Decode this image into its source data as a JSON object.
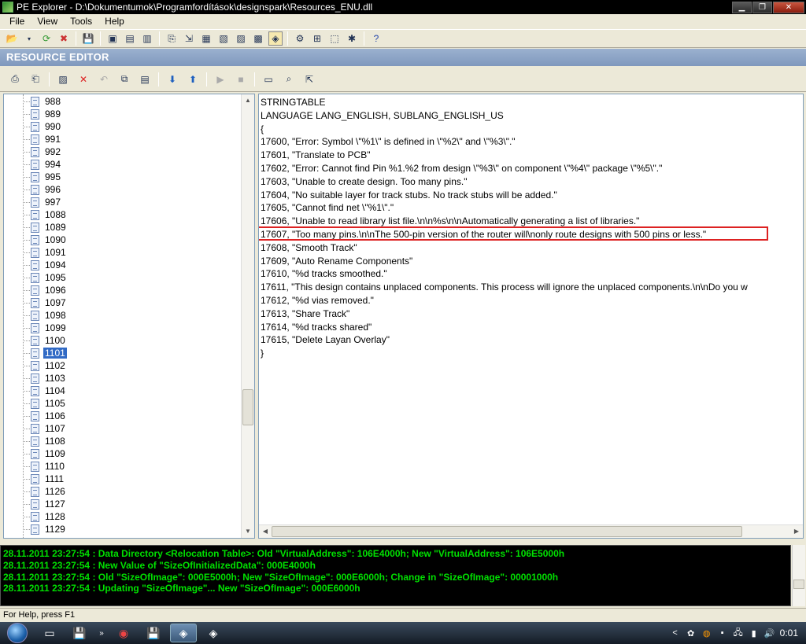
{
  "window": {
    "title": "PE Explorer - D:\\Dokumentumok\\Programfordítások\\designspark\\Resources_ENU.dll",
    "minimize_icon": "minimize-icon",
    "maximize_icon": "restore-icon",
    "close_icon": "close-icon"
  },
  "menu": {
    "file": "File",
    "view": "View",
    "tools": "Tools",
    "help": "Help"
  },
  "resource_editor": {
    "header": "RESOURCE EDITOR"
  },
  "tree": {
    "items": [
      "988",
      "989",
      "990",
      "991",
      "992",
      "994",
      "995",
      "996",
      "997",
      "1088",
      "1089",
      "1090",
      "1091",
      "1094",
      "1095",
      "1096",
      "1097",
      "1098",
      "1099",
      "1100",
      "1101",
      "1102",
      "1103",
      "1104",
      "1105",
      "1106",
      "1107",
      "1108",
      "1109",
      "1110",
      "1111",
      "1126",
      "1127",
      "1128",
      "1129"
    ],
    "selected": "1101"
  },
  "editor": {
    "lines": [
      "STRINGTABLE",
      "LANGUAGE LANG_ENGLISH, SUBLANG_ENGLISH_US",
      "{",
      "17600, \"Error: Symbol \\\"%1\\\" is defined in \\\"%2\\\" and \\\"%3\\\".\"",
      "17601, \"Translate to PCB\"",
      "17602, \"Error: Cannot find Pin %1.%2 from design \\\"%3\\\" on component \\\"%4\\\" package \\\"%5\\\".\"",
      "17603, \"Unable to create design. Too many pins.\"",
      "17604, \"No suitable layer for track stubs. No track stubs will be added.\"",
      "17605, \"Cannot find net \\\"%1\\\".\"",
      "17606, \"Unable to read library list file.\\n\\n%s\\n\\nAutomatically generating a list of libraries.\"",
      "17607, \"Too many pins.\\n\\nThe 500-pin version of the router will\\nonly route designs with 500 pins or less.\"",
      "17608, \"Smooth Track\"",
      "17609, \"Auto Rename Components\"",
      "17610, \"%d tracks smoothed.\"",
      "17611, \"This design contains unplaced components. This process will ignore the unplaced components.\\n\\nDo you w",
      "17612, \"%d vias removed.\"",
      "17613, \"Share Track\"",
      "17614, \"%d tracks shared\"",
      "17615, \"Delete Layan Overlay\"",
      "}"
    ],
    "highlighted_line": "17607"
  },
  "log": {
    "lines": [
      "28.11.2011 23:27:54 : Data Directory <Relocation Table>:  Old \"VirtualAddress\": 106E4000h; New \"VirtualAddress\": 106E5000h",
      "28.11.2011 23:27:54 : New Value of \"SizeOfInitializedData\": 000E4000h",
      "28.11.2011 23:27:54 : Old \"SizeOfImage\": 000E5000h; New \"SizeOfImage\": 000E6000h; Change in \"SizeOfImage\": 00001000h",
      "28.11.2011 23:27:54 : Updating \"SizeOfImage\"... New \"SizeOfImage\": 000E6000h"
    ]
  },
  "status": {
    "text": "For Help, press F1"
  },
  "taskbar": {
    "clock": "0:01"
  },
  "colors": {
    "log_text": "#00e000",
    "log_bg": "#000000",
    "selection": "#316ac5",
    "highlight_border": "#dd2222"
  }
}
